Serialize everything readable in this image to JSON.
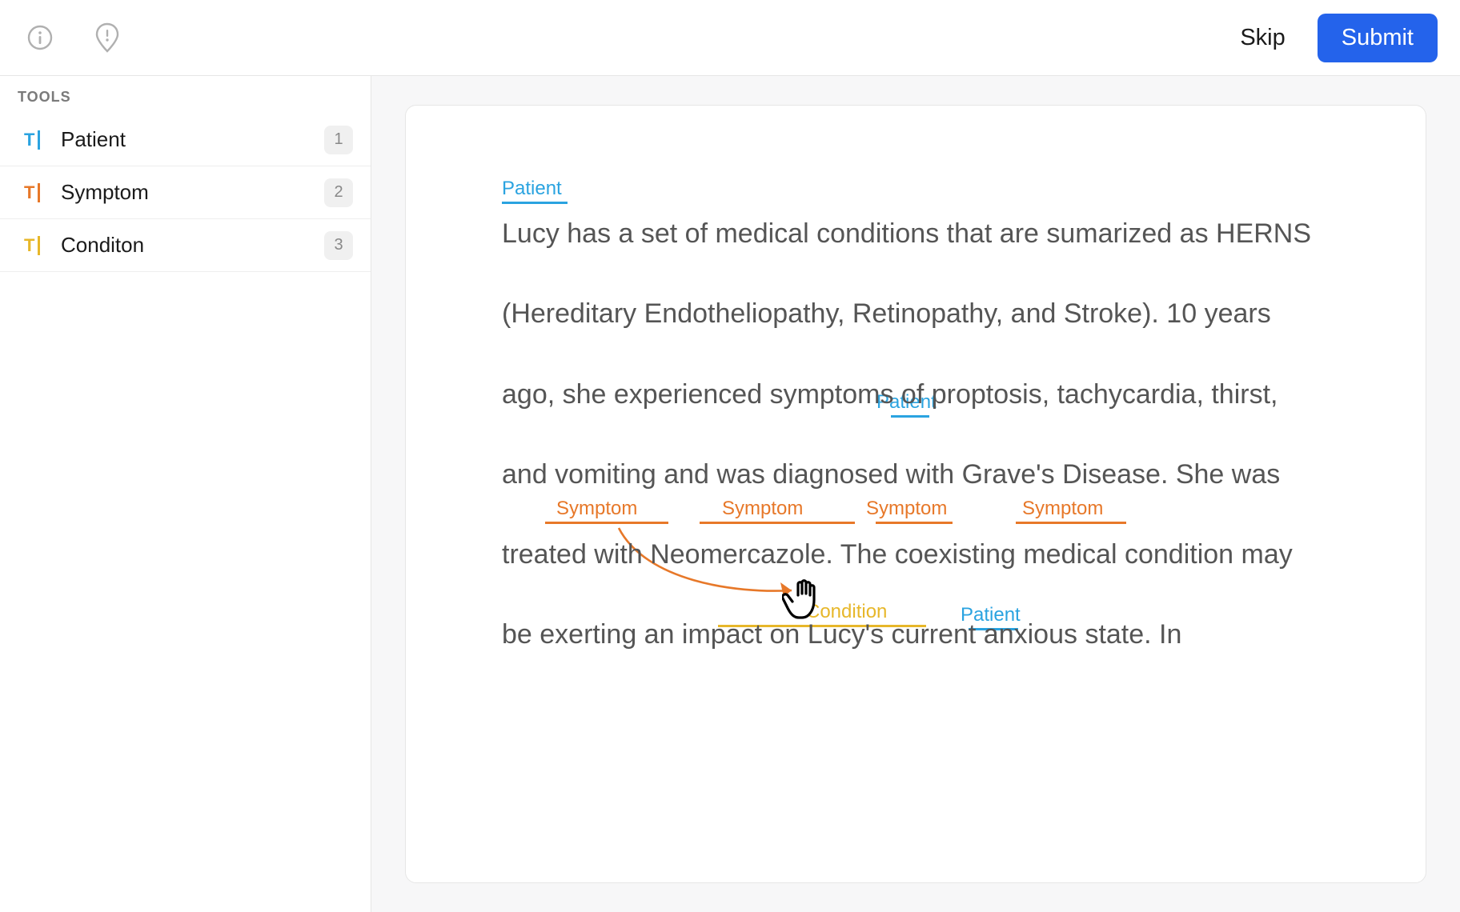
{
  "header": {
    "skip_label": "Skip",
    "submit_label": "Submit"
  },
  "sidebar": {
    "section_title": "TOOLS",
    "tools": [
      {
        "name": "Patient",
        "count": "1",
        "color": "#2aa3e0"
      },
      {
        "name": "Symptom",
        "count": "2",
        "color": "#e77829"
      },
      {
        "name": "Conditon",
        "count": "3",
        "color": "#e7b72a"
      }
    ]
  },
  "document": {
    "text": "Lucy has a set of medical conditions that are sumarized as HERNS (Hereditary Endotheliopathy, Retinopathy, and Stroke). 10 years ago, she experienced symptoms of proptosis, tachycardia, thirst, and vomiting and was diagnosed with Grave's Disease. She was treated with Neomercazole. The coexisting medical condition may be exerting an impact on Lucy's current anxious state. In"
  },
  "annotations": {
    "tags": [
      {
        "label": "Patient",
        "class": "patient",
        "target": "Lucy"
      },
      {
        "label": "Patient",
        "class": "patient",
        "target": "she"
      },
      {
        "label": "Symptom",
        "class": "symptom",
        "target": "proptosis"
      },
      {
        "label": "Symptom",
        "class": "symptom",
        "target": "tachycardia"
      },
      {
        "label": "Symptom",
        "class": "symptom",
        "target": "thirst"
      },
      {
        "label": "Symptom",
        "class": "symptom",
        "target": "vomiting"
      },
      {
        "label": "Condition",
        "class": "condition",
        "target": "Grave's Disease"
      },
      {
        "label": "Patient",
        "class": "patient",
        "target": "She"
      }
    ]
  },
  "colors": {
    "patient": "#2aa3e0",
    "symptom": "#e77829",
    "condition": "#e7b72a",
    "primary": "#2463eb"
  }
}
